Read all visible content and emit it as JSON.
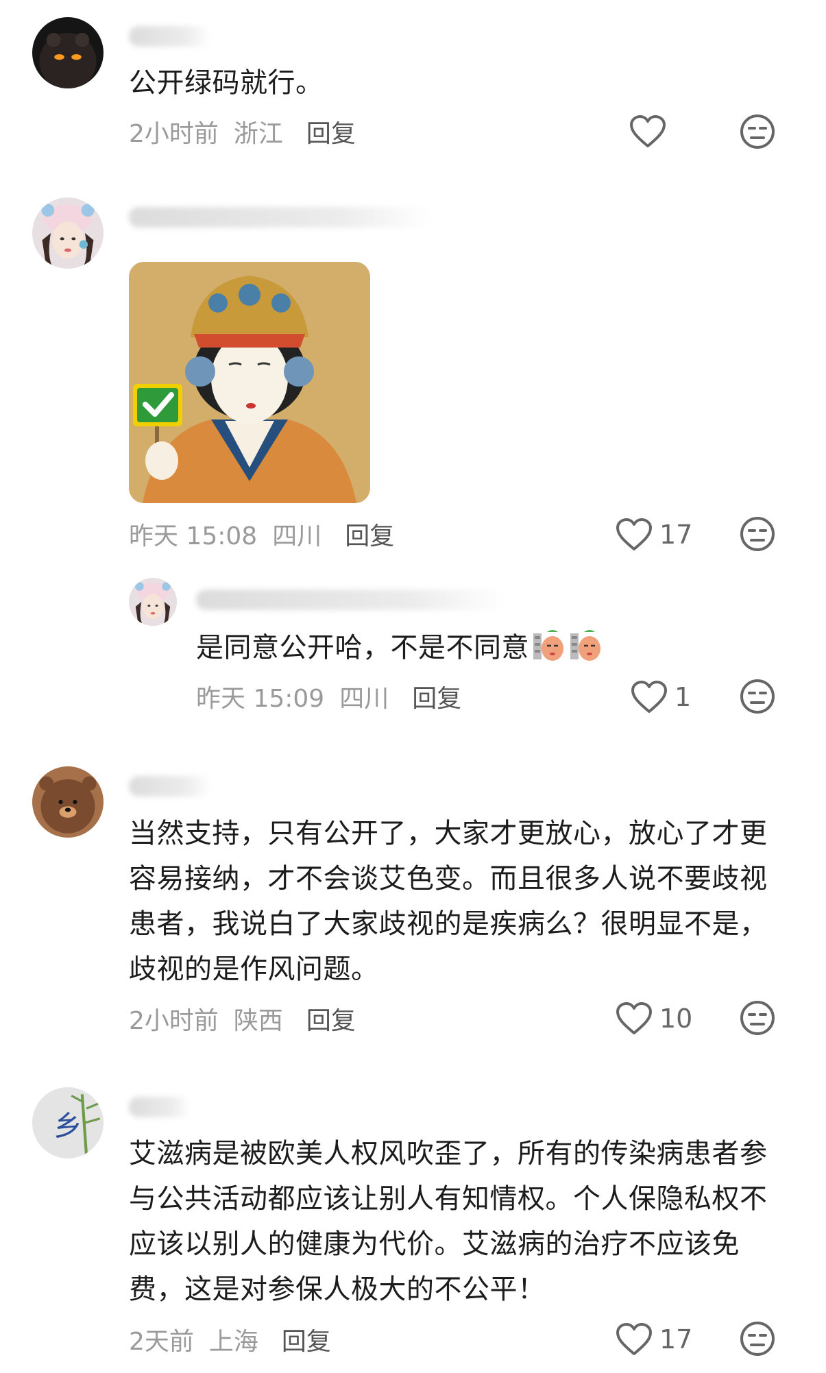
{
  "comments": [
    {
      "text": "公开绿码就行。",
      "time": "2小时前",
      "location": "浙江",
      "reply_label": "回复",
      "likes": ""
    },
    {
      "time": "昨天 15:08",
      "location": "四川",
      "reply_label": "回复",
      "likes": "17",
      "replies": [
        {
          "text": "是同意公开哈，不是不同意",
          "time": "昨天 15:09",
          "location": "四川",
          "reply_label": "回复",
          "likes": "1"
        }
      ]
    },
    {
      "text": "当然支持，只有公开了，大家才更放心，放心了才更容易接纳，才不会谈艾色变。而且很多人说不要歧视患者，我说白了大家歧视的是疾病么？很明显不是，歧视的是作风问题。",
      "time": "2小时前",
      "location": "陕西",
      "reply_label": "回复",
      "likes": "10"
    },
    {
      "text": "艾滋病是被欧美人权风吹歪了，所有的传染病患者参与公共活动都应该让别人有知情权。个人保隐私权不应该以别人的健康为代价。艾滋病的治疗不应该免费，这是对参保人极大的不公平！",
      "time": "2天前",
      "location": "上海",
      "reply_label": "回复",
      "likes": "17"
    }
  ],
  "colors": {
    "text": "#1c1c1c",
    "meta": "#9a9a9a",
    "icon": "#666666",
    "background": "#ffffff"
  },
  "icons": {
    "like": "heart-outline-icon",
    "dislike": "unamused-face-icon",
    "sticker_check": "green-check-icon"
  }
}
